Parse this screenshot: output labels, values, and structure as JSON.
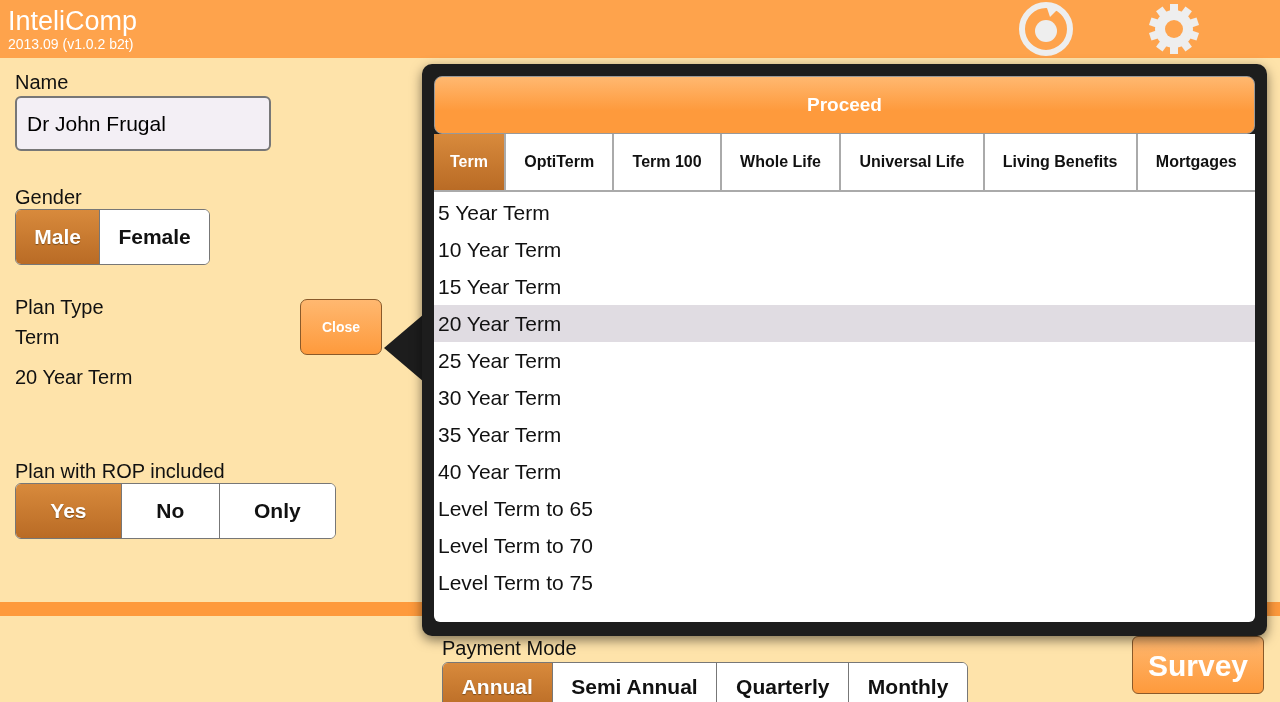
{
  "header": {
    "title": "InteliComp",
    "version": "2013.09 (v1.0.2 b2t)"
  },
  "name_field": {
    "label": "Name",
    "value": "Dr John Frugal"
  },
  "gender": {
    "label": "Gender",
    "options": [
      {
        "label": "Male",
        "selected": true
      },
      {
        "label": "Female",
        "selected": false
      }
    ]
  },
  "plan_type": {
    "label": "Plan Type",
    "category": "Term",
    "plan": "20 Year Term"
  },
  "close_button": "Close",
  "rop": {
    "label": "Plan with ROP included",
    "options": [
      {
        "label": "Yes",
        "selected": true
      },
      {
        "label": "No",
        "selected": false
      },
      {
        "label": "Only",
        "selected": false
      }
    ]
  },
  "popup": {
    "proceed_button": "Proceed",
    "tabs": [
      {
        "label": "Term",
        "selected": true
      },
      {
        "label": "OptiTerm",
        "selected": false
      },
      {
        "label": "Term 100",
        "selected": false
      },
      {
        "label": "Whole Life",
        "selected": false
      },
      {
        "label": "Universal Life",
        "selected": false
      },
      {
        "label": "Living Benefits",
        "selected": false
      },
      {
        "label": "Mortgages",
        "selected": false
      }
    ],
    "items": [
      {
        "label": "5 Year Term",
        "selected": false
      },
      {
        "label": "10 Year Term",
        "selected": false
      },
      {
        "label": "15 Year Term",
        "selected": false
      },
      {
        "label": "20 Year Term",
        "selected": true
      },
      {
        "label": "25 Year Term",
        "selected": false
      },
      {
        "label": "30 Year Term",
        "selected": false
      },
      {
        "label": "35 Year Term",
        "selected": false
      },
      {
        "label": "40 Year Term",
        "selected": false
      },
      {
        "label": "Level Term to 65",
        "selected": false
      },
      {
        "label": "Level Term to 70",
        "selected": false
      },
      {
        "label": "Level Term to 75",
        "selected": false
      }
    ]
  },
  "payment_mode": {
    "label": "Payment Mode",
    "options": [
      {
        "label": "Annual",
        "selected": true
      },
      {
        "label": "Semi Annual",
        "selected": false
      },
      {
        "label": "Quarterly",
        "selected": false
      },
      {
        "label": "Monthly",
        "selected": false
      }
    ]
  },
  "survey_button": "Survey"
}
